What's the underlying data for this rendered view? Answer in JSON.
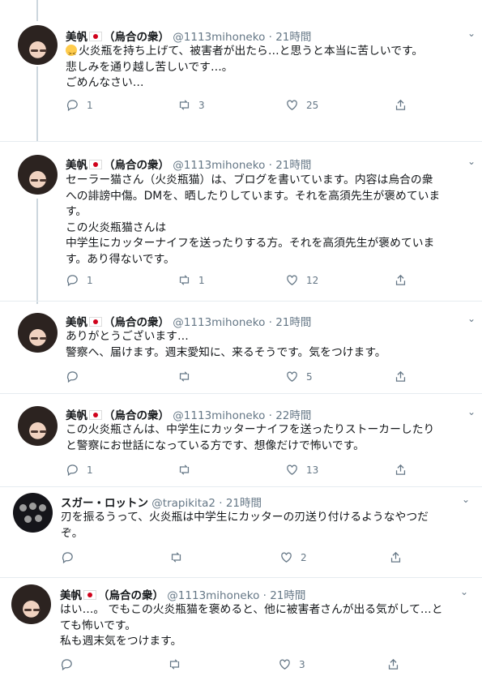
{
  "tweets": [
    {
      "name": "美帆",
      "affiliation": "（烏合の衆）",
      "handle": "@1113mihoneko",
      "time": "21時間",
      "text": "火炎瓶を持ち上げて、被害者が出たら…と思うと本当に苦しいです。\n悲しみを通り越し苦しいです…。\nごめんなさい…",
      "replies": "1",
      "retweets": "3",
      "likes": "25"
    },
    {
      "name": "美帆",
      "affiliation": "（烏合の衆）",
      "handle": "@1113mihoneko",
      "time": "21時間",
      "text": "セーラー猫さん（火炎瓶猫）は、ブログを書いています。内容は烏合の衆\nへの誹謗中傷。DMを、晒したりしています。それを高須先生が褒めていま\nす。\nこの火炎瓶猫さんは\n中学生にカッターナイフを送ったりする方。それを高須先生が褒めていま\nす。あり得ないです。",
      "replies": "1",
      "retweets": "1",
      "likes": "12"
    },
    {
      "name": "美帆",
      "affiliation": "（烏合の衆）",
      "handle": "@1113mihoneko",
      "time": "21時間",
      "text": "ありがとうございます…\n警察へ、届けます。週末愛知に、来るそうです。気をつけます。",
      "replies": "",
      "retweets": "",
      "likes": "5"
    },
    {
      "name": "美帆",
      "affiliation": "（烏合の衆）",
      "handle": "@1113mihoneko",
      "time": "22時間",
      "text": "この火炎瓶さんは、中学生にカッターナイフを送ったりストーカーしたり\nと警察にお世話になっている方です、想像だけで怖いです。",
      "replies": "1",
      "retweets": "",
      "likes": "13"
    },
    {
      "name": "スガー・ロットン",
      "affiliation": "",
      "handle": "@trapikita2",
      "time": "21時間",
      "text": "刃を振るうって、火炎瓶は中学生にカッターの刃送り付けるようなやつだ\nぞ。",
      "replies": "",
      "retweets": "",
      "likes": "2"
    },
    {
      "name": "美帆",
      "affiliation": "（烏合の衆）",
      "handle": "@1113mihoneko",
      "time": "21時間",
      "text": "はい…。 でもこの火炎瓶猫を褒めると、他に被害者さんが出る気がして…と\nても怖いです。\n私も週末気をつけます。",
      "replies": "",
      "retweets": "",
      "likes": "3"
    }
  ],
  "icons": {
    "reply": "reply-icon",
    "retweet": "retweet-icon",
    "like": "heart-icon",
    "share": "share-icon",
    "more": "chevron-down-icon"
  },
  "colors": {
    "meta": "#657786",
    "text": "#14171a",
    "line": "#ccd6dd"
  }
}
